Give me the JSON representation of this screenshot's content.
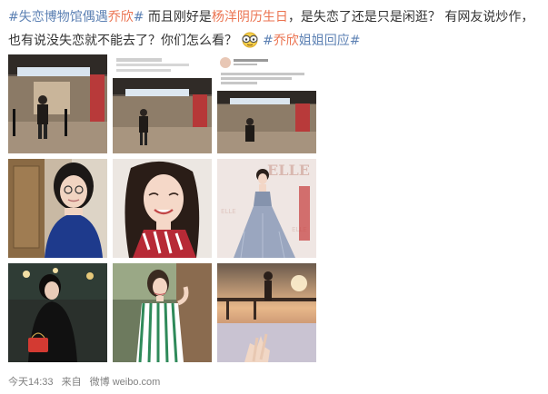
{
  "post": {
    "tag1": "#失恋博物馆偶遇乔欣#",
    "tag1_prefix": "#失恋博物馆偶遇",
    "tag1_name": "乔欣",
    "tag1_suffix": "#",
    "text1": " 而且刚好是",
    "link1": "杨洋阴历生日",
    "text2": "，是失恋了还是只是闲逛？ 有网友说炒作，也有说没失恋就不能去了？你们怎么看？",
    "emoji_name": "sunglasses-emoji",
    "tag2_prefix": "#",
    "tag2_name": "乔欣",
    "tag2_suffix": "姐姐回应#"
  },
  "images": [
    {
      "name": "museum-entrance-photo"
    },
    {
      "name": "museum-entrance-screenshot"
    },
    {
      "name": "comment-screenshot-photo"
    },
    {
      "name": "glasses-selfie-photo"
    },
    {
      "name": "smiling-portrait-photo"
    },
    {
      "name": "red-carpet-gown-photo"
    },
    {
      "name": "street-night-photo"
    },
    {
      "name": "striped-dress-photo"
    },
    {
      "name": "sunset-silhouette-photo"
    }
  ],
  "screenshot_text": {
    "line1": "#失恋博物馆偶遇乔欣#",
    "line2": "本人真的超好看 又高又瘦 人也特别好",
    "line3": "ps：不要在博物馆",
    "line4": "ps：不要的话删图"
  },
  "footer": {
    "time": "今天14:33",
    "from": "来自",
    "source": "微博 weibo.com"
  },
  "colors": {
    "hashtag": "#eb7350",
    "tag_blue": "#5e82b4",
    "text": "#333333",
    "meta": "#808080"
  }
}
